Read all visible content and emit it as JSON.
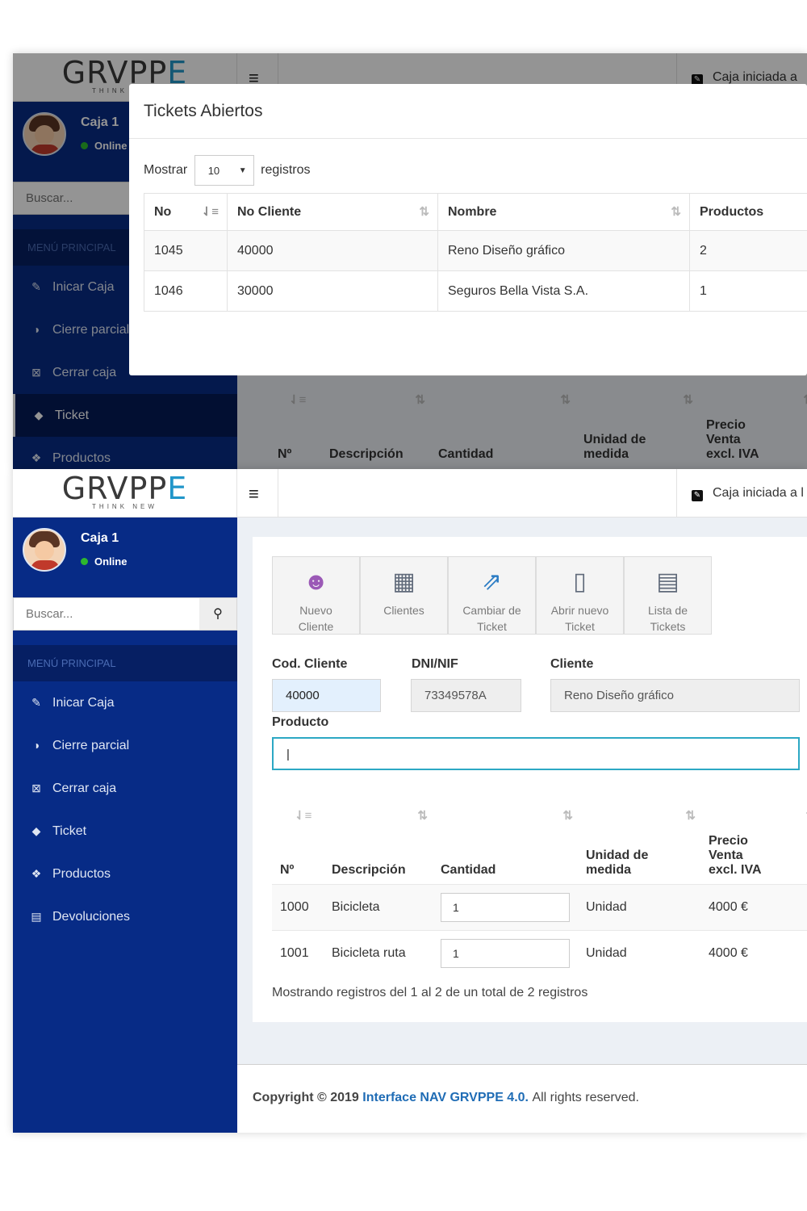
{
  "header": {
    "brand": "GRVPP",
    "brand_accent": "E",
    "tagline": "THINK NEW",
    "menu_icon": "hamburger-icon",
    "status_text": "Caja iniciada a l",
    "status_text_top": "Caja iniciada a"
  },
  "sidebar": {
    "user_name": "Caja 1",
    "user_status": "Online",
    "search_placeholder": "Buscar...",
    "menu_header": "MENÚ PRINCIPAL",
    "items": [
      {
        "label": "Inicar Caja",
        "icon": "edit-icon"
      },
      {
        "label": "Cierre parcial",
        "icon": "half-circle-icon"
      },
      {
        "label": "Cerrar caja",
        "icon": "close-box-icon"
      },
      {
        "label": "Ticket",
        "icon": "tag-icon"
      },
      {
        "label": "Productos",
        "icon": "cubes-icon"
      },
      {
        "label": "Devoluciones",
        "icon": "document-icon"
      }
    ]
  },
  "toolbar": [
    {
      "label1": "Nuevo",
      "label2": "Cliente",
      "icon": "new-client-icon"
    },
    {
      "label1": "Clientes",
      "label2": "",
      "icon": "clients-table-icon"
    },
    {
      "label1": "Cambiar de",
      "label2": "Ticket",
      "icon": "change-ticket-icon"
    },
    {
      "label1": "Abrir nuevo",
      "label2": "Ticket",
      "icon": "new-ticket-icon"
    },
    {
      "label1": "Lista de",
      "label2": "Tickets",
      "icon": "ticket-list-icon"
    }
  ],
  "form": {
    "cod_cliente_label": "Cod. Cliente",
    "cod_cliente_value": "40000",
    "dni_label": "DNI/NIF",
    "dni_value": "73349578A",
    "cliente_label": "Cliente",
    "cliente_value": "Reno Diseño gráfico",
    "producto_label": "Producto",
    "producto_value": ""
  },
  "products_table": {
    "headers": [
      "Nº",
      "Descripción",
      "Cantidad",
      "Unidad de",
      "medida",
      "Precio",
      "Venta",
      "excl. IVA"
    ],
    "rows": [
      {
        "no": "1000",
        "desc": "Bicicleta",
        "qty": "1",
        "unit": "Unidad",
        "price": "4000 €"
      },
      {
        "no": "1001",
        "desc": "Bicicleta ruta",
        "qty": "1",
        "unit": "Unidad",
        "price": "4000 €"
      }
    ],
    "summary": "Mostrando registros del 1 al 2 de un total de 2 registros"
  },
  "footer": {
    "prefix": "Copyright © 2019",
    "link": "Interface NAV GRVPPE 4.0.",
    "suffix": "All rights reserved."
  },
  "modal": {
    "title": "Tickets Abiertos",
    "show_label": "Mostrar",
    "show_value": "10",
    "records_label": "registros",
    "headers": [
      "No",
      "No Cliente",
      "Nombre",
      "Productos"
    ],
    "rows": [
      {
        "no": "1045",
        "client": "40000",
        "name": "Reno Diseño gráfico",
        "products": "2"
      },
      {
        "no": "1046",
        "client": "30000",
        "name": "Seguros Bella Vista S.A.",
        "products": "1"
      }
    ]
  },
  "colors": {
    "sidebar": "#072b86",
    "sidebar_dark": "#061f63",
    "accent": "#2196c9",
    "link": "#1f6cb5",
    "online": "#2eb82e"
  }
}
